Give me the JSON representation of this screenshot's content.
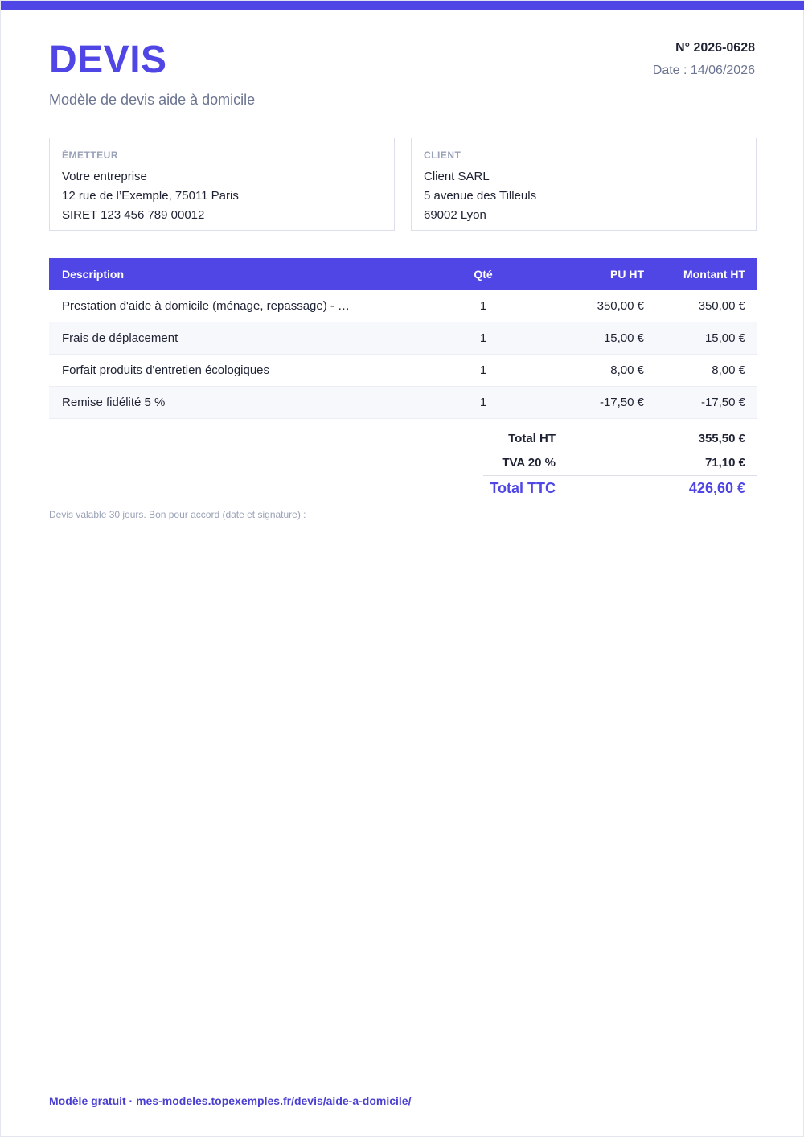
{
  "header": {
    "title": "DEVIS",
    "subtitle": "Modèle de devis aide à domicile",
    "number": "N° 2026-0628",
    "date": "Date : 14/06/2026"
  },
  "emitter": {
    "label": "ÉMETTEUR",
    "lines": [
      "Votre entreprise",
      "12 rue de l’Exemple, 75011 Paris",
      "SIRET 123 456 789 00012"
    ]
  },
  "client": {
    "label": "CLIENT",
    "lines": [
      "Client SARL",
      "5 avenue des Tilleuls",
      "69002 Lyon"
    ]
  },
  "table": {
    "headers": [
      "Description",
      "Qté",
      "PU HT",
      "Montant HT"
    ],
    "rows": [
      {
        "desc": "Prestation d'aide à domicile (ménage, repassage) - …",
        "qty": "1",
        "pu": "350,00 €",
        "amount": "350,00 €"
      },
      {
        "desc": "Frais de déplacement",
        "qty": "1",
        "pu": "15,00 €",
        "amount": "15,00 €"
      },
      {
        "desc": "Forfait produits d'entretien écologiques",
        "qty": "1",
        "pu": "8,00 €",
        "amount": "8,00 €"
      },
      {
        "desc": "Remise fidélité 5 %",
        "qty": "1",
        "pu": "-17,50 €",
        "amount": "-17,50 €"
      }
    ]
  },
  "totals": {
    "ht_label": "Total HT",
    "ht_value": "355,50 €",
    "tva_label": "TVA 20 %",
    "tva_value": "71,10 €",
    "ttc_label": "Total TTC",
    "ttc_value": "426,60 €"
  },
  "note": "Devis valable 30 jours. Bon pour accord (date et signature) :",
  "footer": "Modèle gratuit · mes-modeles.topexemples.fr/devis/aide-a-domicile/",
  "colors": {
    "accent": "#5046e5",
    "muted": "#6b7491",
    "light": "#9aa2b8"
  }
}
